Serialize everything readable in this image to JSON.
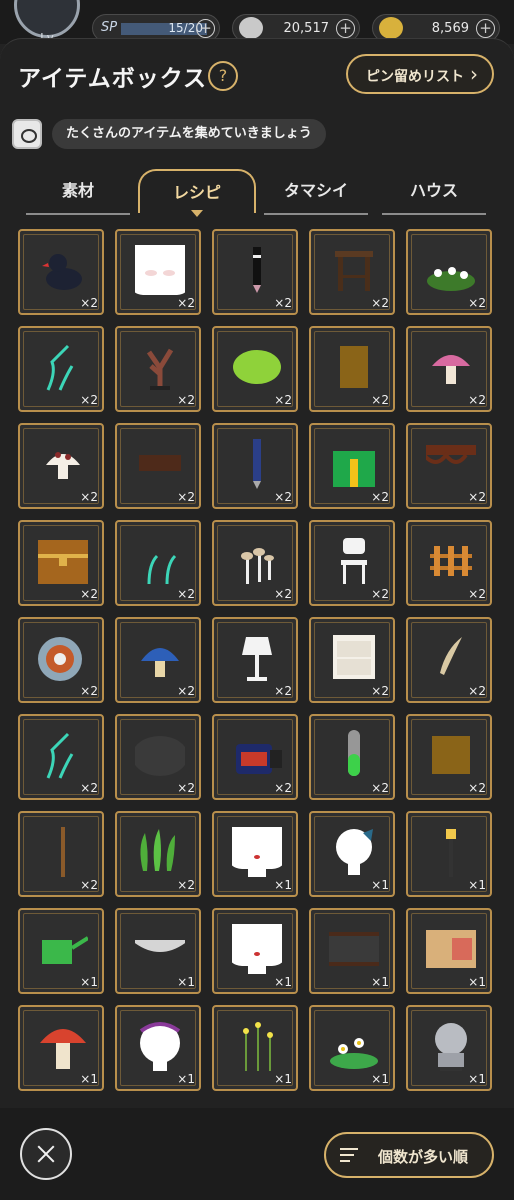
{
  "status": {
    "level_label": "Lv",
    "sp_label": "SP",
    "sp_value": "15/20",
    "currency1": "20,517",
    "currency2": "8,569"
  },
  "panel": {
    "title": "アイテムボックス",
    "help_label": "?",
    "pin_list_label": "ピン留めリスト",
    "hint_text": "たくさんのアイテムを集めていきましょう"
  },
  "tabs": [
    {
      "label": "素材",
      "active": false
    },
    {
      "label": "レシピ",
      "active": true
    },
    {
      "label": "タマシイ",
      "active": false
    },
    {
      "label": "ハウス",
      "active": false
    }
  ],
  "items": [
    {
      "icon": "duck-icon",
      "qty": "×2"
    },
    {
      "icon": "face-icon",
      "qty": "×2"
    },
    {
      "icon": "pen-icon",
      "qty": "×2"
    },
    {
      "icon": "stool-icon",
      "qty": "×2"
    },
    {
      "icon": "flower-bush-icon",
      "qty": "×2"
    },
    {
      "icon": "glow-vine-icon",
      "qty": "×2"
    },
    {
      "icon": "coral-icon",
      "qty": "×2"
    },
    {
      "icon": "green-oval-icon",
      "qty": "×2"
    },
    {
      "icon": "gold-card-icon",
      "qty": "×2"
    },
    {
      "icon": "pink-mushroom-icon",
      "qty": "×2"
    },
    {
      "icon": "spotted-mushroom-icon",
      "qty": "×2"
    },
    {
      "icon": "brown-block-icon",
      "qty": "×2"
    },
    {
      "icon": "blue-pen-icon",
      "qty": "×2"
    },
    {
      "icon": "gift-box-icon",
      "qty": "×2"
    },
    {
      "icon": "table-icon",
      "qty": "×2"
    },
    {
      "icon": "treasure-chest-icon",
      "qty": "×2"
    },
    {
      "icon": "glow-sprout-icon",
      "qty": "×2"
    },
    {
      "icon": "small-mushrooms-icon",
      "qty": "×2"
    },
    {
      "icon": "chair-icon",
      "qty": "×2"
    },
    {
      "icon": "fence-icon",
      "qty": "×2"
    },
    {
      "icon": "thread-spool-icon",
      "qty": "×2"
    },
    {
      "icon": "blue-mushroom-icon",
      "qty": "×2"
    },
    {
      "icon": "lamp-icon",
      "qty": "×2"
    },
    {
      "icon": "nightstand-icon",
      "qty": "×2"
    },
    {
      "icon": "feather-icon",
      "qty": "×2"
    },
    {
      "icon": "glow-vine-icon",
      "qty": "×2"
    },
    {
      "icon": "stone-icon",
      "qty": "×2"
    },
    {
      "icon": "ink-bottle-icon",
      "qty": "×2"
    },
    {
      "icon": "test-tube-icon",
      "qty": "×2"
    },
    {
      "icon": "gold-square-icon",
      "qty": "×2"
    },
    {
      "icon": "wand-icon",
      "qty": "×2"
    },
    {
      "icon": "green-leaves-icon",
      "qty": "×2"
    },
    {
      "icon": "head-icon",
      "qty": "×1"
    },
    {
      "icon": "butterfly-head-icon",
      "qty": "×1"
    },
    {
      "icon": "street-lamp-icon",
      "qty": "×1"
    },
    {
      "icon": "watering-can-icon",
      "qty": "×1"
    },
    {
      "icon": "lace-icon",
      "qty": "×1"
    },
    {
      "icon": "head-icon",
      "qty": "×1"
    },
    {
      "icon": "frame-icon",
      "qty": "×1"
    },
    {
      "icon": "cardboard-box-icon",
      "qty": "×1"
    },
    {
      "icon": "red-mushroom-icon",
      "qty": "×1"
    },
    {
      "icon": "headband-head-icon",
      "qty": "×1"
    },
    {
      "icon": "wildflowers-icon",
      "qty": "×1"
    },
    {
      "icon": "daisy-bush-icon",
      "qty": "×1"
    },
    {
      "icon": "knight-bust-icon",
      "qty": "×1"
    }
  ],
  "footer": {
    "sort_label": "個数が多い順"
  }
}
